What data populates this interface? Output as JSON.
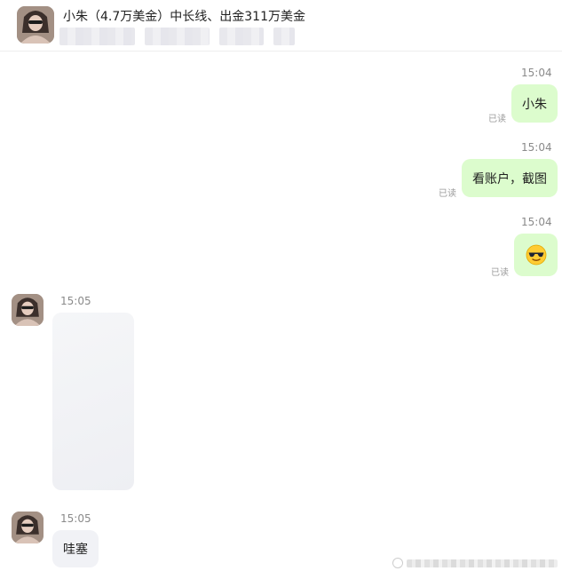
{
  "header": {
    "title": "小朱（4.7万美金）中长线、出金311万美金"
  },
  "messages": [
    {
      "direction": "out",
      "time": "15:04",
      "text": "小朱",
      "read_label": "已读"
    },
    {
      "direction": "out",
      "time": "15:04",
      "text": "看账户，截图",
      "read_label": "已读"
    },
    {
      "direction": "out",
      "time": "15:04",
      "text": "😎",
      "icon": "sunglasses-emoji-icon",
      "read_label": "已读"
    },
    {
      "direction": "in",
      "time": "15:05",
      "type": "image"
    },
    {
      "direction": "in",
      "time": "15:05",
      "text": "哇塞"
    }
  ],
  "colors": {
    "outgoing_bubble": "#dcfccd",
    "incoming_bubble": "#f1f2f6",
    "timestamp": "#8a8a8a"
  }
}
